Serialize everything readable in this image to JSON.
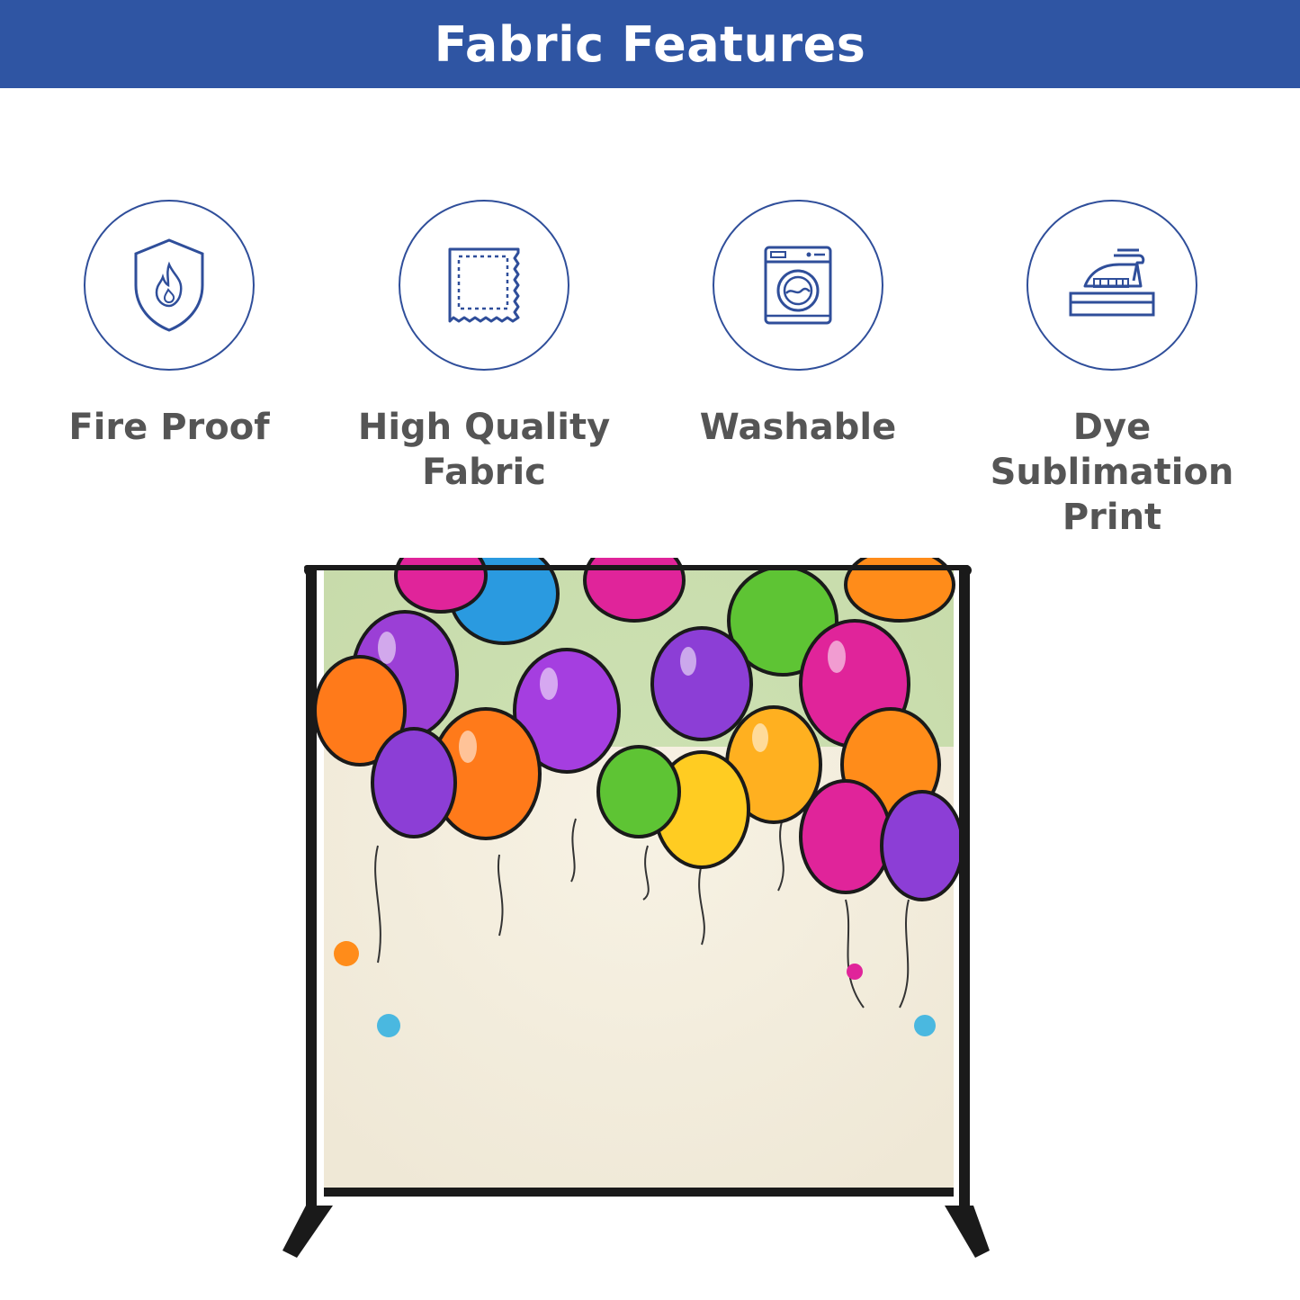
{
  "header": {
    "title": "Fabric Features"
  },
  "features": [
    {
      "label": "Fire Proof",
      "icon": "fire-shield-icon"
    },
    {
      "label": "High Quality\nFabric",
      "icon": "fabric-swatch-icon"
    },
    {
      "label": "Washable",
      "icon": "washing-machine-icon"
    },
    {
      "label": "Dye Sublimation\nPrint",
      "icon": "iron-icon"
    }
  ],
  "colors": {
    "header_bg": "#2f55a3",
    "icon_stroke": "#2f4e9a",
    "label_text": "#555555",
    "backdrop_bg": "#f4efe1",
    "stand_frame": "#1a1a1a"
  },
  "product_image": {
    "icon": "balloon-backdrop-stand-image"
  }
}
